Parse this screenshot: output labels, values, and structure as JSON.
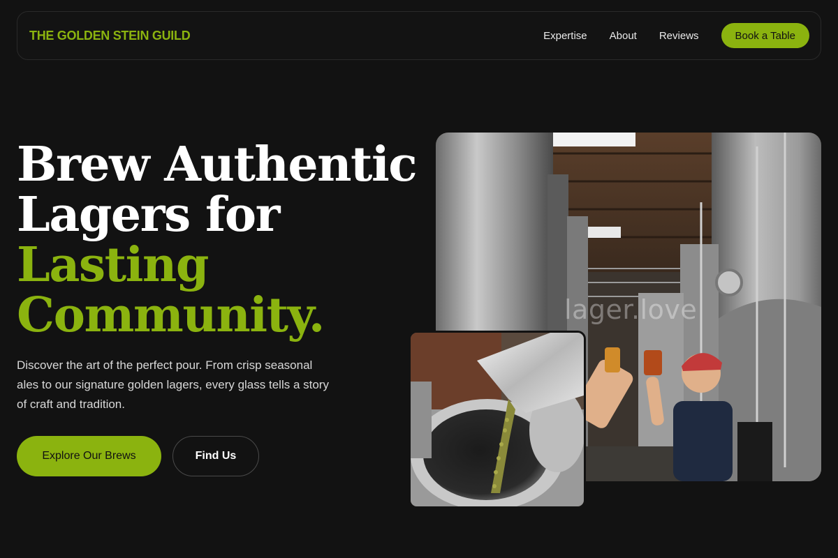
{
  "nav": {
    "brand": "THE GOLDEN STEIN GUILD",
    "links": [
      "Expertise",
      "About",
      "Reviews"
    ],
    "cta": "Book a Table"
  },
  "hero": {
    "headline_line1": "Brew Authentic",
    "headline_line2": "Lagers for",
    "headline_accent1": "Lasting",
    "headline_accent2": "Community.",
    "description": "Discover the art of the perfect pour. From crisp seasonal ales to our signature golden lagers, every glass tells a story of craft and tradition.",
    "primary_button": "Explore Our Brews",
    "secondary_button": "Find Us"
  },
  "images": {
    "watermark": "lager.love",
    "main_photo": "brewery-tanks-toast-photo",
    "inset_photo": "hops-pouring-into-kettle-photo"
  },
  "colors": {
    "background": "#121212",
    "accent": "#8bb30f",
    "text": "#ffffff"
  }
}
